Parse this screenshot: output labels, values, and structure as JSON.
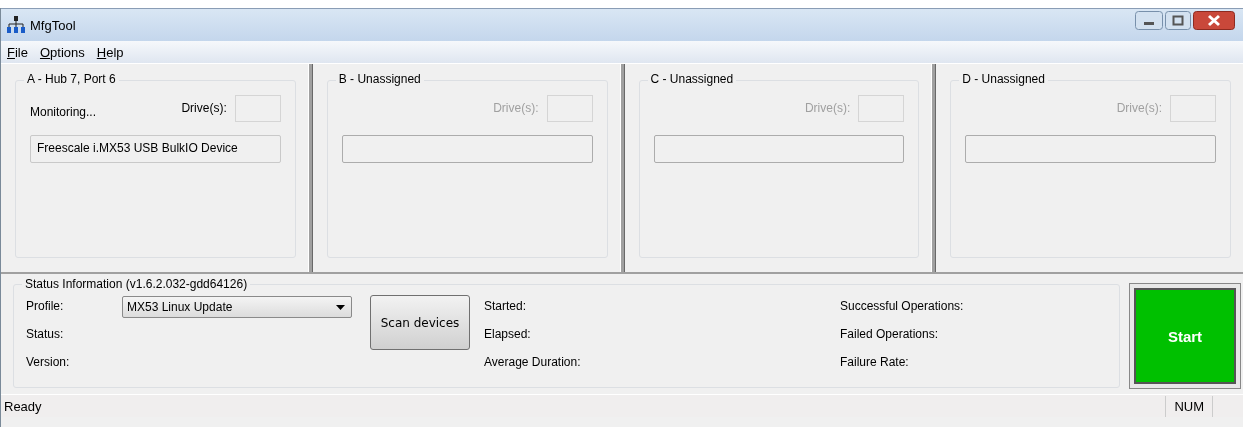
{
  "window": {
    "title": "MfgTool"
  },
  "menu": [
    {
      "label": "File"
    },
    {
      "label": "Options"
    },
    {
      "label": "Help"
    }
  ],
  "ports": [
    {
      "title": "A - Hub 7, Port 6",
      "disabled": false,
      "status": "Monitoring...",
      "drive_label": "Drive(s):",
      "device": "Freescale i.MX53 USB BulkIO Device"
    },
    {
      "title": "B - Unassigned",
      "disabled": true,
      "drive_label": "Drive(s):"
    },
    {
      "title": "C - Unassigned",
      "disabled": true,
      "drive_label": "Drive(s):"
    },
    {
      "title": "D - Unassigned",
      "disabled": true,
      "drive_label": "Drive(s):"
    }
  ],
  "status_info": {
    "title": "Status Information (v1.6.2.032-gdd64126)",
    "profile_label": "Profile:",
    "profile": "MX53 Linux Update",
    "status_label": "Status:",
    "version_label": "Version:",
    "scan_button": "Scan devices",
    "stats_left": [
      "Started:",
      "Elapsed:",
      "Average Duration:"
    ],
    "stats_right": [
      "Successful Operations:",
      "Failed Operations:",
      "Failure Rate:"
    ]
  },
  "start_button": "Start",
  "status_bar": {
    "text": "Ready",
    "indicator": "NUM"
  }
}
